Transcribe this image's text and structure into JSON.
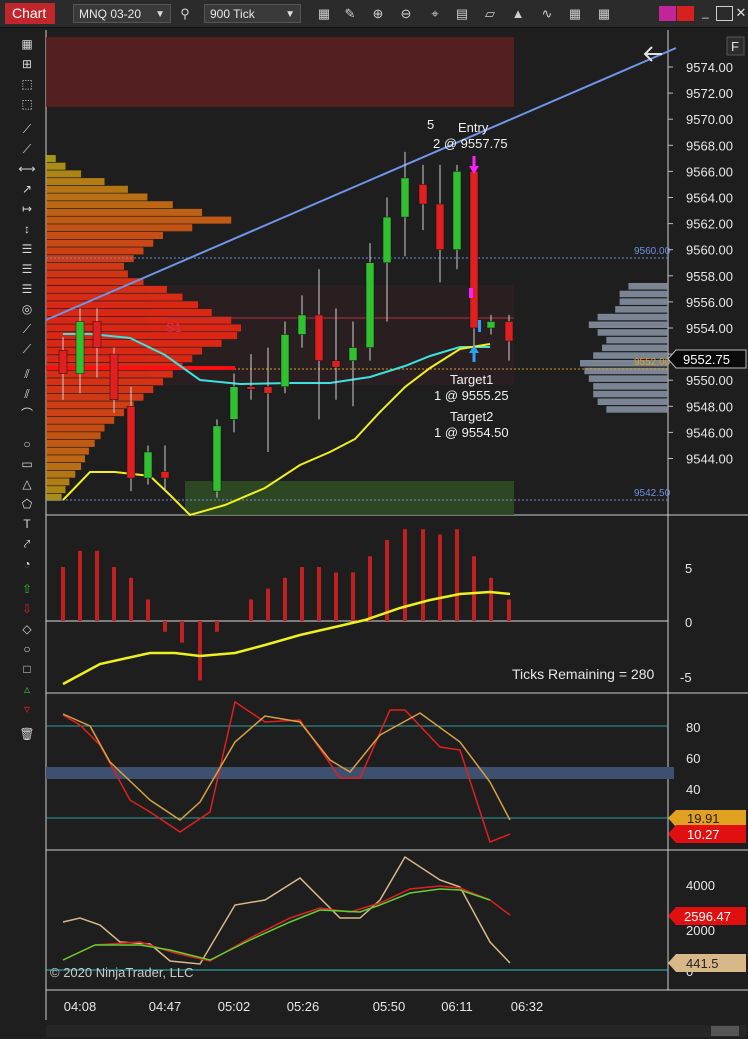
{
  "toolbar": {
    "chart_tab": "Chart",
    "instrument": "MNQ 03-20",
    "interval": "900 Tick",
    "icons": [
      "bar-type-icon",
      "draw-pencil-icon",
      "zoom-in-icon",
      "zoom-out-icon",
      "crosshair-icon",
      "properties-icon",
      "strategies-icon",
      "indicators-icon",
      "templates-icon",
      "data-box-icon"
    ],
    "colors": {
      "tab": "#c0262b",
      "magenta": "#c2259a",
      "red": "#d72020"
    }
  },
  "left_toolbar_icons": [
    "ruler-icon",
    "risk-reward-icon",
    "region-icon",
    "region-highlight-icon",
    "line-icon",
    "ray-icon",
    "extended-line-icon",
    "arrow-line-icon",
    "horizontal-line-icon",
    "vertical-line-icon",
    "fib-retracement-icon",
    "fib-extension-icon",
    "fib-time-icon",
    "fib-circle-icon",
    "andrews-pitchfork-icon",
    "gann-fan-icon",
    "regression-channel-icon",
    "trend-channel-icon",
    "arc-icon",
    "ellipse-icon",
    "rectangle-icon",
    "triangle-icon",
    "polygon-icon",
    "text-icon",
    "path-icon",
    "time-cycles-icon",
    "arrow-up-icon",
    "arrow-down-icon",
    "diamond-icon",
    "dot-icon",
    "square-icon",
    "triangle-up-icon",
    "triangle-down-icon",
    "remove-all-icon"
  ],
  "price_panel": {
    "f_label": "F",
    "y_ticks": [
      "9574.00",
      "9572.00",
      "9570.00",
      "9568.00",
      "9566.00",
      "9564.00",
      "9562.00",
      "9560.00",
      "9558.00",
      "9556.00",
      "9554.00",
      "9552.00",
      "9550.00",
      "9548.00",
      "9546.00",
      "9544.00"
    ],
    "last_price": "9552.75",
    "line_label_9560": "9560.00",
    "line_label_9552": "9552.00",
    "line_label_9542": "9542.50",
    "s1_label": "S1",
    "count_label": "5",
    "entry_label": "Entry",
    "entry_detail": "2 @ 9557.75",
    "target1_label": "Target1",
    "target1_detail": "1 @ 9555.25",
    "target2_label": "Target2",
    "target2_detail": "1 @ 9554.50"
  },
  "momentum_panel": {
    "y_ticks": [
      "5",
      "0",
      "-5"
    ],
    "ticks_remaining": "Ticks Remaining = 280"
  },
  "stoch_panel": {
    "y_ticks": [
      "80",
      "60",
      "40"
    ],
    "value_d": "19.91",
    "value_k": "10.27"
  },
  "volume_panel": {
    "y_ticks": [
      "4000",
      "2000",
      "0"
    ],
    "value_red": "2596.47",
    "value_tan": "441.5",
    "copyright": "© 2020 NinjaTrader, LLC"
  },
  "x_axis": [
    "04:08",
    "04:47",
    "05:02",
    "05:26",
    "05:50",
    "06:11",
    "06:32"
  ]
}
